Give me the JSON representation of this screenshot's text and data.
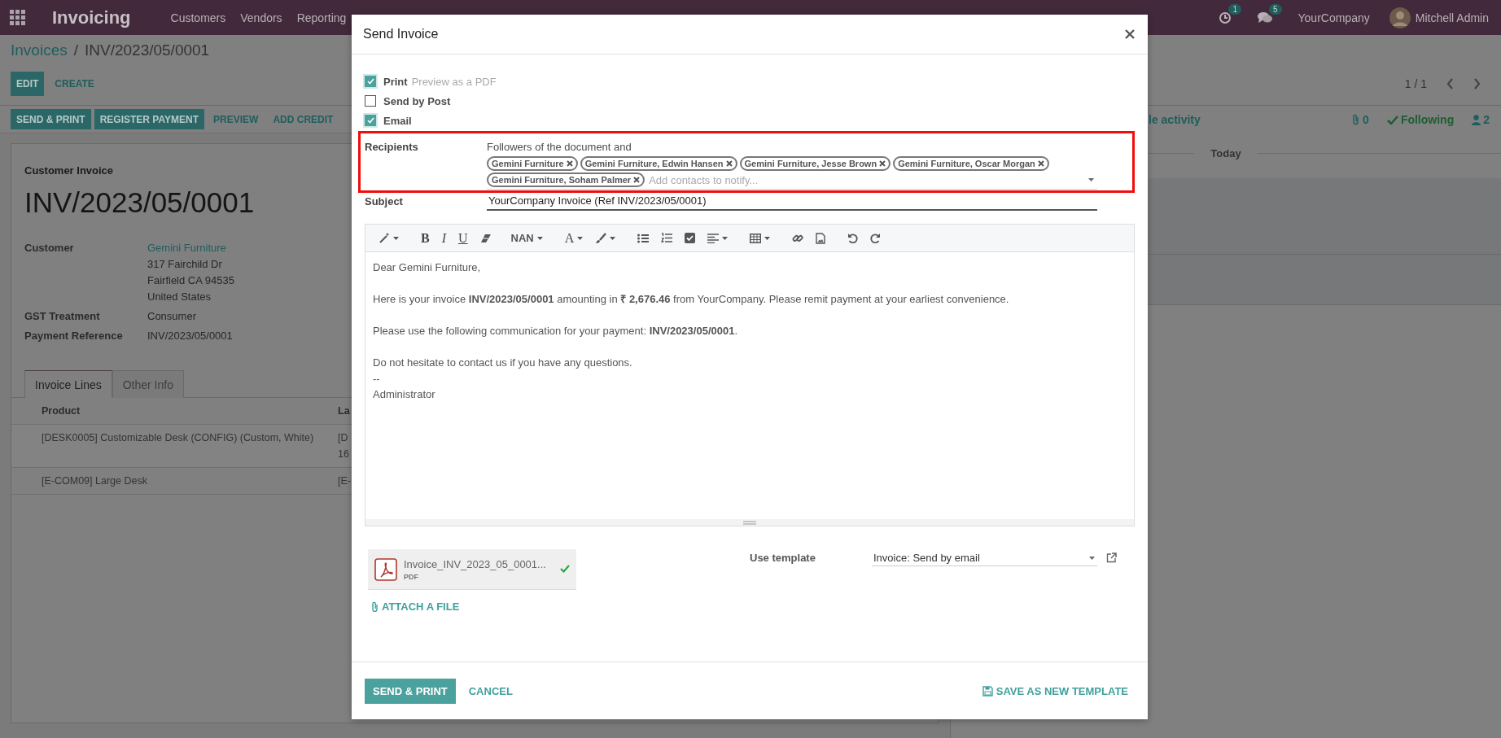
{
  "navbar": {
    "app": "Invoicing",
    "menus": [
      "Customers",
      "Vendors",
      "Reporting"
    ],
    "activity_count": "1",
    "message_count": "5",
    "company": "YourCompany",
    "user": "Mitchell Admin"
  },
  "breadcrumbs": {
    "items": [
      "Invoices",
      "INV/2023/05/0001"
    ],
    "separator": "/"
  },
  "main_buttons": [
    {
      "label": "EDIT",
      "kind": "primary"
    },
    {
      "label": "CREATE",
      "kind": "link"
    }
  ],
  "pager": "1 / 1",
  "action_buttons": [
    {
      "label": "SEND & PRINT",
      "kind": "primary"
    },
    {
      "label": "REGISTER PAYMENT",
      "kind": "primary"
    },
    {
      "label": "PREVIEW",
      "kind": "link"
    },
    {
      "label": "ADD CREDIT",
      "kind": "link"
    }
  ],
  "chatter": {
    "activity": "le activity",
    "attachments": "0",
    "follow": "Following",
    "followers": "2",
    "date_separator": "Today"
  },
  "invoice": {
    "type": "Customer Invoice",
    "number": "INV/2023/05/0001",
    "fields": [
      {
        "label": "Customer",
        "value": "Gemini Furniture",
        "link": true,
        "address": [
          "317 Fairchild Dr",
          "Fairfield CA 94535",
          "United States"
        ]
      },
      {
        "label": "GST Treatment",
        "value": "Consumer",
        "link": false
      },
      {
        "label": "Payment Reference",
        "value": "INV/2023/05/0001",
        "link": false
      }
    ],
    "tabs": [
      {
        "label": "Invoice Lines",
        "selected": true
      },
      {
        "label": "Other Info",
        "selected": false
      }
    ],
    "table": {
      "columns": [
        "Product",
        "La"
      ],
      "rows": [
        [
          "[DESK0005] Customizable Desk (CONFIG) (Custom, White)",
          "[D\n16"
        ],
        [
          "[E-COM09] Large Desk",
          "[E-"
        ]
      ]
    }
  },
  "dialog": {
    "title": "Send Invoice",
    "options": [
      {
        "label": "Print",
        "hint": "Preview as a PDF",
        "checked": true
      },
      {
        "label": "Send by Post",
        "checked": false
      },
      {
        "label": "Email",
        "checked": true
      }
    ],
    "recipients": {
      "label": "Recipients",
      "intro": "Followers of the document and",
      "tags": [
        "Gemini Furniture",
        "Gemini Furniture, Edwin Hansen",
        "Gemini Furniture, Jesse Brown",
        "Gemini Furniture, Oscar Morgan",
        "Gemini Furniture, Soham Palmer"
      ],
      "placeholder": "Add contacts to notify...",
      "highlighted": true
    },
    "subject": {
      "label": "Subject",
      "value": "YourCompany Invoice (Ref INV/2023/05/0001)"
    },
    "editor": {
      "text_buttons": [
        {
          "label": "B",
          "kind": "bold"
        },
        {
          "label": "I",
          "kind": "italic"
        },
        {
          "label": "U",
          "kind": "underline"
        }
      ],
      "font_size": "NAN",
      "font_color": "A",
      "paragraphs": [
        [
          "Dear Gemini Furniture,"
        ],
        [
          "Here is your invoice **INV/2023/05/0001** amounting in **₹ 2,676.46** from YourCompany. Please remit payment at your earliest convenience."
        ],
        [
          "Please use the following communication for your payment: **INV/2023/05/0001**."
        ],
        [
          "Do not hesitate to contact us if you have any questions.",
          "--",
          "Administrator"
        ]
      ]
    },
    "attachment": {
      "name": "Invoice_INV_2023_05_0001...",
      "type": "PDF",
      "uploaded": true
    },
    "attach_label": "ATTACH A FILE",
    "template": {
      "label": "Use template",
      "value": "Invoice: Send by email"
    },
    "footer_buttons": [
      {
        "label": "SEND & PRINT",
        "kind": "primary"
      },
      {
        "label": "CANCEL",
        "kind": "link"
      }
    ],
    "save_template": "SAVE AS NEW TEMPLATE"
  }
}
